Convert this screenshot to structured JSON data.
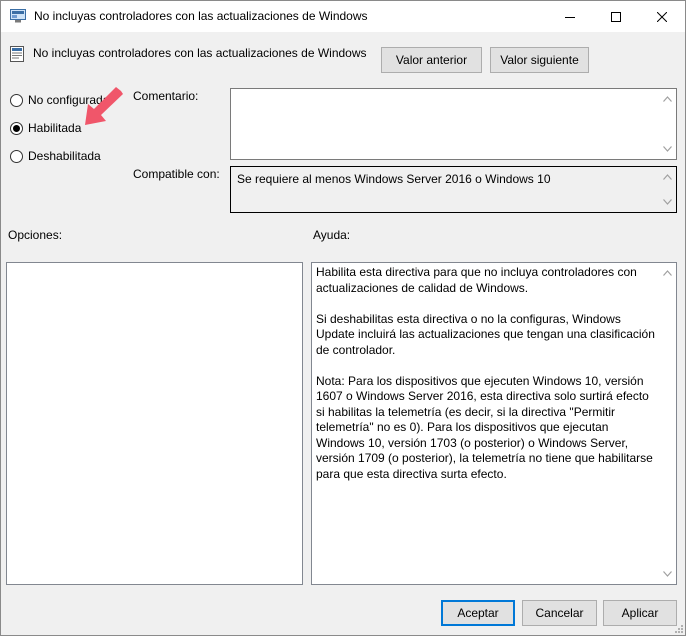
{
  "window": {
    "title": "No incluyas controladores con las actualizaciones de Windows"
  },
  "header": {
    "policy_name": "No incluyas controladores con las actualizaciones de Windows",
    "prev_button": "Valor anterior",
    "next_button": "Valor siguiente"
  },
  "state": {
    "options": [
      {
        "label": "No configurada",
        "selected": false
      },
      {
        "label": "Habilitada",
        "selected": true
      },
      {
        "label": "Deshabilitada",
        "selected": false
      }
    ]
  },
  "comment": {
    "label": "Comentario:",
    "value": ""
  },
  "supported": {
    "label": "Compatible con:",
    "value": "Se requiere al menos Windows Server 2016 o Windows 10"
  },
  "options_panel": {
    "label": "Opciones:"
  },
  "help_panel": {
    "label": "Ayuda:",
    "text": "Habilita esta directiva para que no incluya controladores con actualizaciones de calidad de Windows.\n\nSi deshabilitas esta directiva o no la configuras, Windows Update incluirá las actualizaciones que tengan una clasificación de controlador.\n\nNota: Para los dispositivos que ejecuten Windows 10, versión 1607 o Windows Server 2016, esta directiva solo surtirá efecto si habilitas la telemetría (es decir, si la directiva \"Permitir telemetría\" no es 0). Para los dispositivos que ejecutan Windows 10, versión 1703 (o posterior) o Windows Server, versión 1709 (o posterior), la telemetría no tiene que habilitarse para que esta directiva surta efecto."
  },
  "footer": {
    "accept": "Aceptar",
    "cancel": "Cancelar",
    "apply": "Aplicar"
  },
  "colors": {
    "accent": "#0078d7",
    "annotation_arrow": "#f0566a"
  }
}
